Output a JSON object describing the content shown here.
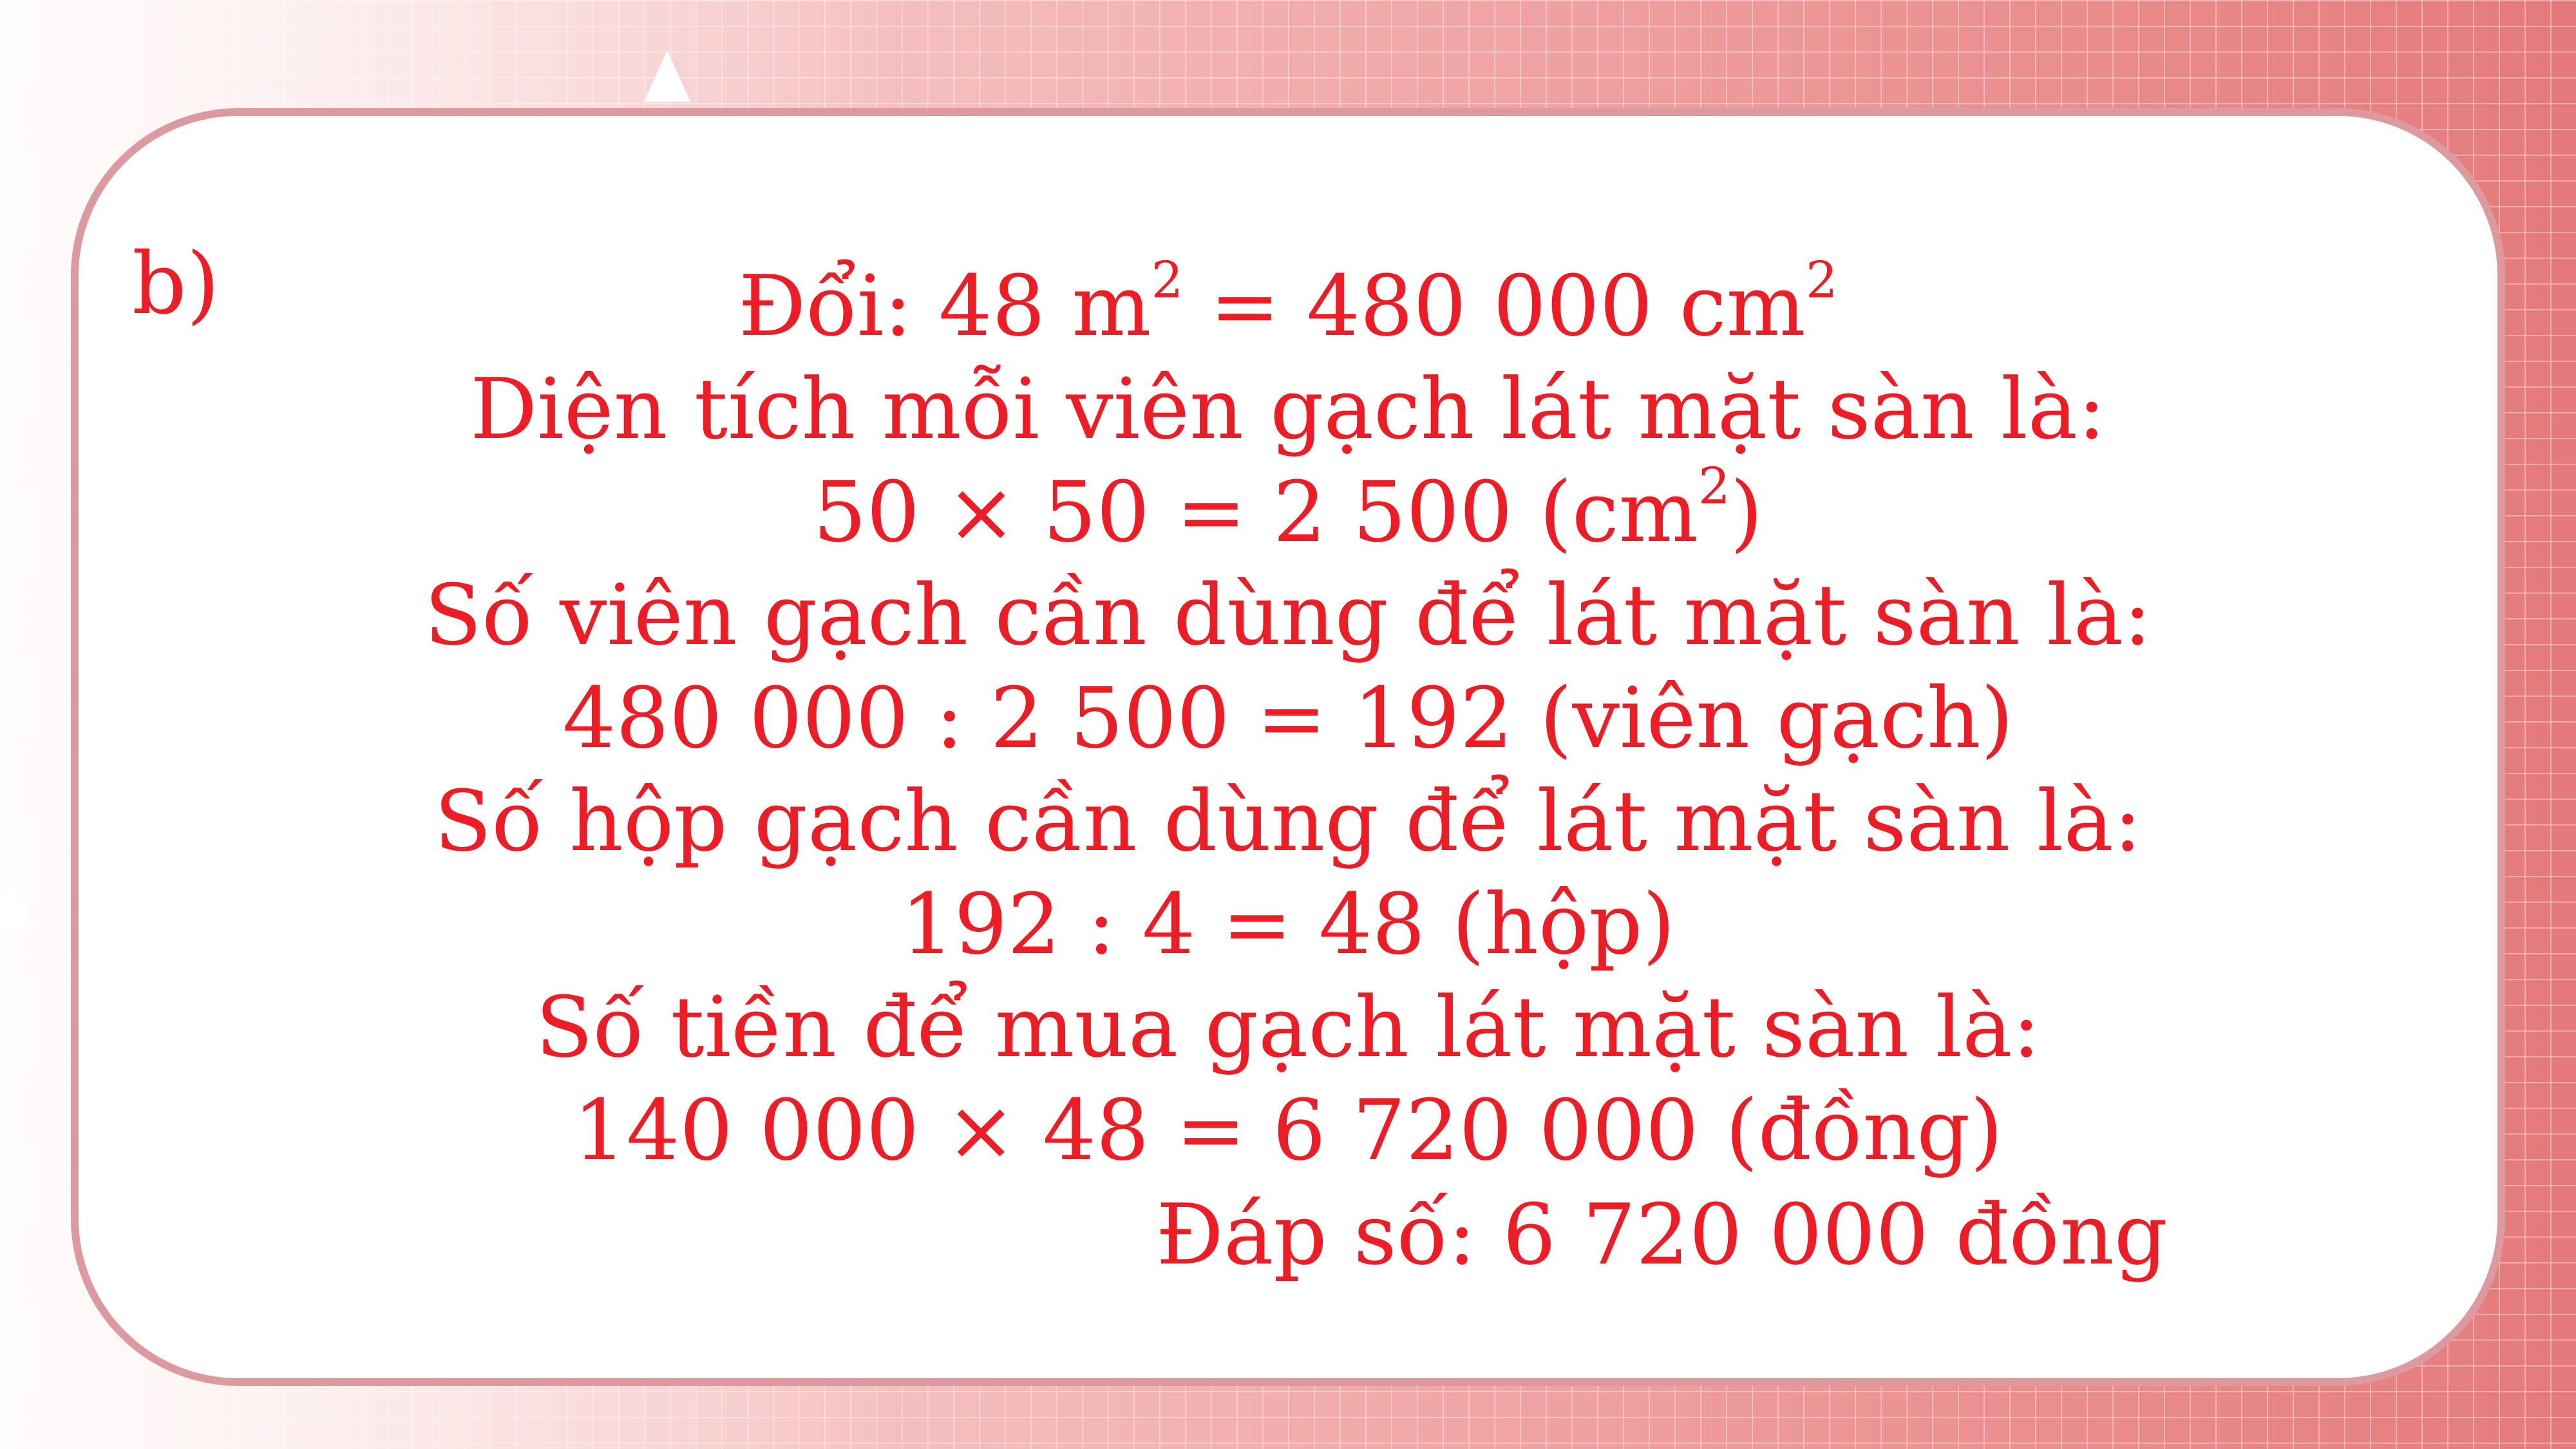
{
  "colors": {
    "text": "#ee1c24",
    "card_border": "#dc9a9e",
    "card_fill": "#ffffff"
  },
  "label": "b)",
  "solution": {
    "l1_a": "Đổi: 48 m",
    "l1_sup1": "2",
    "l1_b": " = 480 000 cm",
    "l1_sup2": "2",
    "l2": "Diện tích mỗi viên gạch lát mặt sàn là:",
    "l3_a": "50 × 50 = 2 500 (cm",
    "l3_sup": "2",
    "l3_b": ")",
    "l4": "Số viên gạch cần dùng để lát mặt sàn là:",
    "l5": "480 000 : 2 500 = 192 (viên gạch)",
    "l6": "Số hộp gạch cần dùng để lát mặt sàn là:",
    "l7": "192 : 4 = 48 (hộp)",
    "l8": "Số tiền để mua gạch lát mặt sàn là:",
    "l9": "140 000 × 48 = 6 720 000 (đồng)"
  },
  "answer": "Đáp số: 6 720 000 đồng"
}
